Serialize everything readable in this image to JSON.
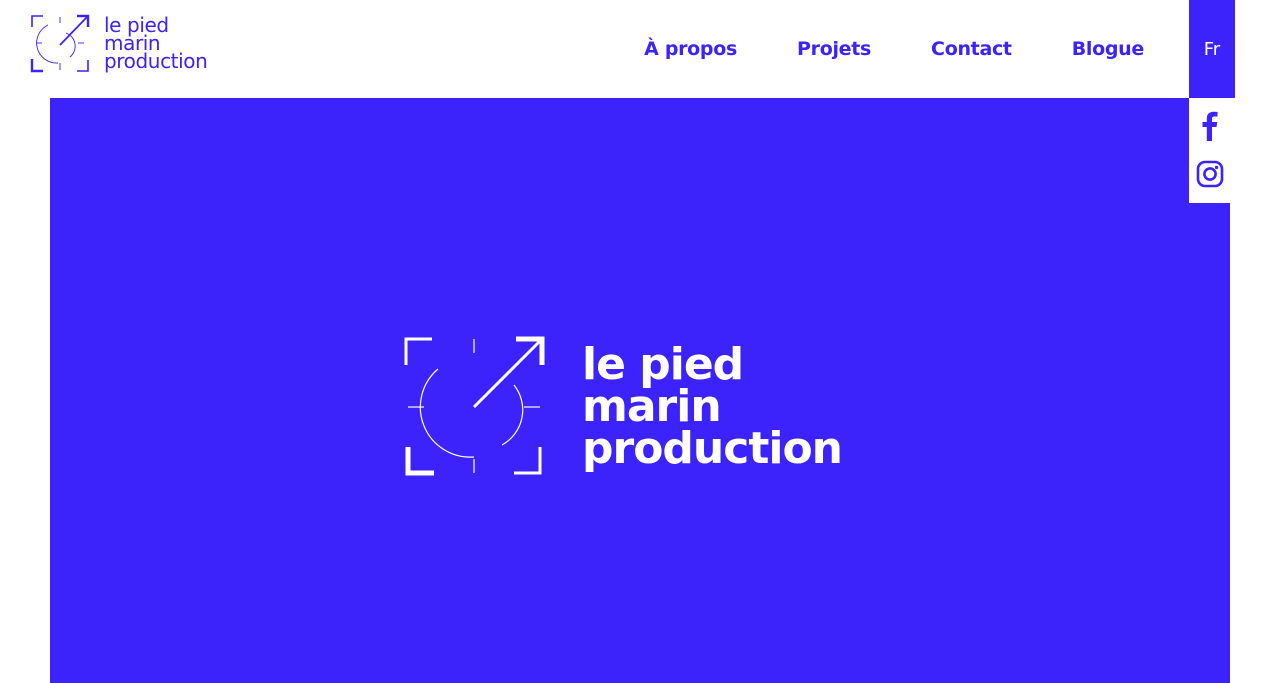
{
  "brand": {
    "name_line1": "le pied",
    "name_line2": "marin",
    "name_line3": "production",
    "color": "#3c22fb"
  },
  "nav": {
    "items": [
      {
        "label": "À propos"
      },
      {
        "label": "Projets"
      },
      {
        "label": "Contact"
      },
      {
        "label": "Blogue"
      }
    ],
    "language": "Fr"
  },
  "hero": {
    "background": "#3c22fb",
    "logo_line1": "le pied",
    "logo_line2": "marin",
    "logo_line3": "production"
  },
  "social": {
    "icons": [
      "facebook-icon",
      "instagram-icon"
    ]
  }
}
